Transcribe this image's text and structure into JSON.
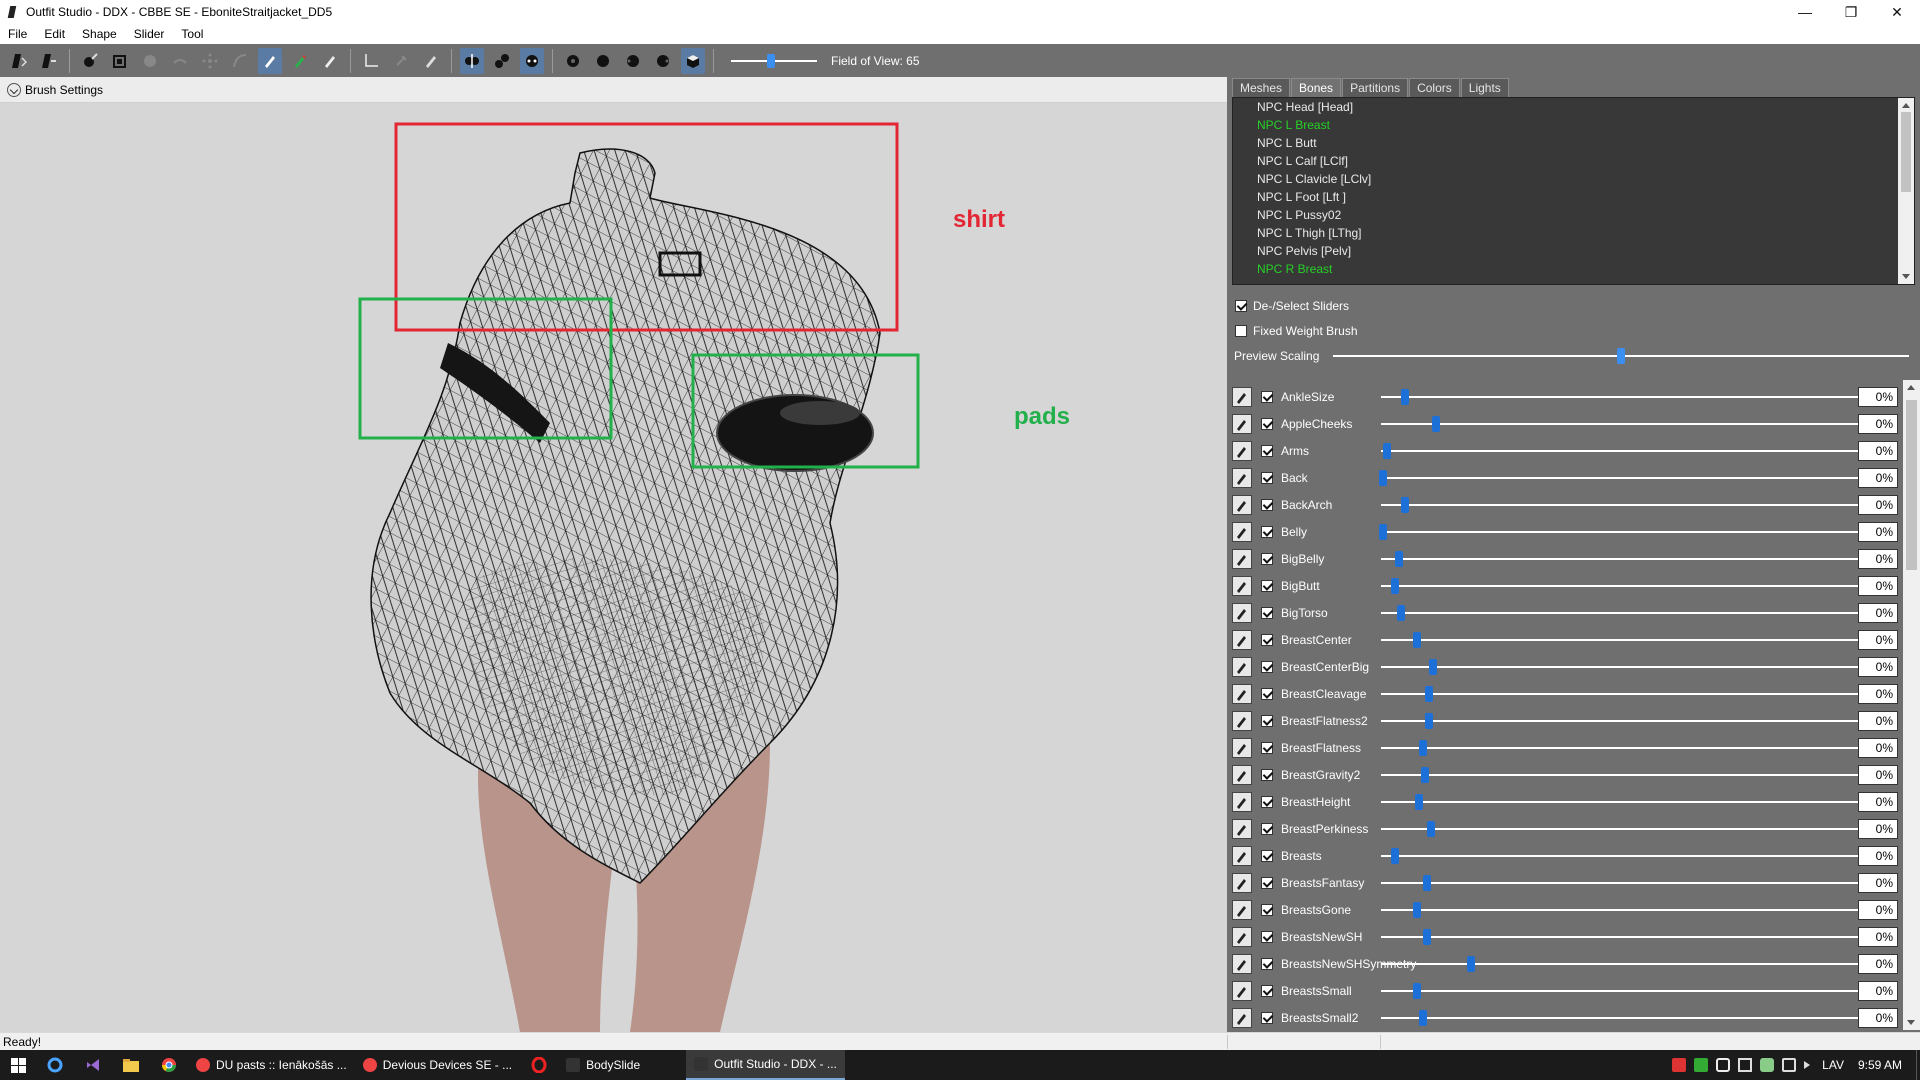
{
  "window": {
    "title": "Outfit Studio - DDX - CBBE SE - EboniteStraitjacket_DD5",
    "minimize": "—",
    "restore": "❐",
    "close": "✕"
  },
  "menu": [
    "File",
    "Edit",
    "Shape",
    "Slider",
    "Tool"
  ],
  "toolbar": {
    "fov_label": "Field of View: 65",
    "fov_value": 0.42
  },
  "brush_settings": {
    "label": "Brush Settings"
  },
  "annotations": {
    "shirt": {
      "label": "shirt",
      "color": "#e32633"
    },
    "pads": {
      "label": "pads",
      "color": "#22b04a"
    }
  },
  "tabs": [
    {
      "label": "Meshes",
      "active": false
    },
    {
      "label": "Bones",
      "active": true
    },
    {
      "label": "Partitions",
      "active": false
    },
    {
      "label": "Colors",
      "active": false
    },
    {
      "label": "Lights",
      "active": false
    }
  ],
  "bones": [
    {
      "label": "NPC Head [Head]",
      "selected": false
    },
    {
      "label": "NPC L Breast",
      "selected": true
    },
    {
      "label": "NPC L Butt",
      "selected": false
    },
    {
      "label": "NPC L Calf [LClf]",
      "selected": false
    },
    {
      "label": "NPC L Clavicle [LClv]",
      "selected": false
    },
    {
      "label": "NPC L Foot [Lft ]",
      "selected": false
    },
    {
      "label": "NPC L Pussy02",
      "selected": false
    },
    {
      "label": "NPC L Thigh [LThg]",
      "selected": false
    },
    {
      "label": "NPC Pelvis [Pelv]",
      "selected": false
    },
    {
      "label": "NPC R Breast",
      "selected": true
    }
  ],
  "options": {
    "deselect_sliders": "De-/Select Sliders",
    "fixed_weight_brush": "Fixed Weight Brush",
    "preview_scaling": "Preview Scaling",
    "preview_scaling_value": 0.5
  },
  "sliders": [
    {
      "name": "AnkleSize",
      "value": "0%",
      "pos": 0.0
    },
    {
      "name": "AppleCheeks",
      "value": "0%",
      "pos": 0.03
    },
    {
      "name": "Arms",
      "value": "0%",
      "pos": 0.0
    },
    {
      "name": "Back",
      "value": "0%",
      "pos": 0.0
    },
    {
      "name": "BackArch",
      "value": "0%",
      "pos": 0.0
    },
    {
      "name": "Belly",
      "value": "0%",
      "pos": 0.0
    },
    {
      "name": "BigBelly",
      "value": "0%",
      "pos": 0.0
    },
    {
      "name": "BigButt",
      "value": "0%",
      "pos": 0.0
    },
    {
      "name": "BigTorso",
      "value": "0%",
      "pos": 0.0
    },
    {
      "name": "BreastCenter",
      "value": "0%",
      "pos": 0.0
    },
    {
      "name": "BreastCenterBig",
      "value": "0%",
      "pos": 0.0
    },
    {
      "name": "BreastCleavage",
      "value": "0%",
      "pos": 0.0
    },
    {
      "name": "BreastFlatness2",
      "value": "0%",
      "pos": 0.0
    },
    {
      "name": "BreastFlatness",
      "value": "0%",
      "pos": 0.0
    },
    {
      "name": "BreastGravity2",
      "value": "0%",
      "pos": 0.0
    },
    {
      "name": "BreastHeight",
      "value": "0%",
      "pos": 0.0
    },
    {
      "name": "BreastPerkiness",
      "value": "0%",
      "pos": 0.0
    },
    {
      "name": "Breasts",
      "value": "0%",
      "pos": 0.0
    },
    {
      "name": "BreastsFantasy",
      "value": "0%",
      "pos": 0.0
    },
    {
      "name": "BreastsGone",
      "value": "0%",
      "pos": 0.0
    },
    {
      "name": "BreastsNewSH",
      "value": "0%",
      "pos": 0.0
    },
    {
      "name": "BreastsNewSHSymmetry",
      "value": "0%",
      "pos": 0.0
    },
    {
      "name": "BreastsSmall",
      "value": "0%",
      "pos": 0.0
    },
    {
      "name": "BreastsSmall2",
      "value": "0%",
      "pos": 0.0
    }
  ],
  "status": {
    "text": "Ready!"
  },
  "taskbar": {
    "tasks": [
      {
        "label": "DU pasts :: Ienākošās ...",
        "active": false
      },
      {
        "label": "Devious Devices SE - ...",
        "active": false
      },
      {
        "label": "BodySlide",
        "active": false
      },
      {
        "label": "Outfit Studio - DDX - ...",
        "active": true
      }
    ],
    "lang": "LAV",
    "time": "9:59 AM"
  }
}
